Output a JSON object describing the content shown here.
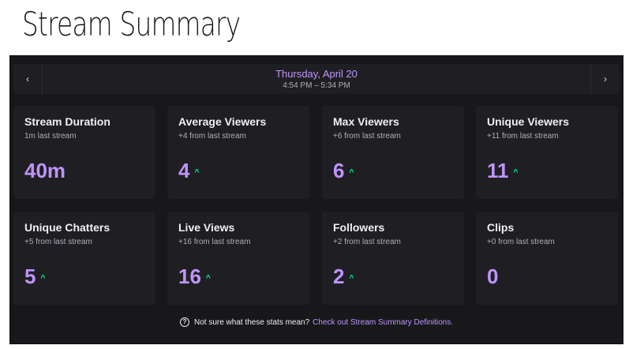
{
  "page_title": "Stream Summary",
  "date_nav": {
    "prev_icon": "‹",
    "next_icon": "›",
    "date": "Thursday, April 20",
    "time_range": "4:54 PM – 5:34 PM"
  },
  "stats": [
    {
      "title": "Stream Duration",
      "subtitle": "1m last stream",
      "value": "40m",
      "trend_icon": ""
    },
    {
      "title": "Average Viewers",
      "subtitle": "+4 from last stream",
      "value": "4",
      "trend_icon": "^"
    },
    {
      "title": "Max Viewers",
      "subtitle": "+6 from last stream",
      "value": "6",
      "trend_icon": "^"
    },
    {
      "title": "Unique Viewers",
      "subtitle": "+11 from last stream",
      "value": "11",
      "trend_icon": "^"
    },
    {
      "title": "Unique Chatters",
      "subtitle": "+5 from last stream",
      "value": "5",
      "trend_icon": "^"
    },
    {
      "title": "Live Views",
      "subtitle": "+16 from last stream",
      "value": "16",
      "trend_icon": "^"
    },
    {
      "title": "Followers",
      "subtitle": "+2 from last stream",
      "value": "2",
      "trend_icon": "^"
    },
    {
      "title": "Clips",
      "subtitle": "+0 from last stream",
      "value": "0",
      "trend_icon": ""
    }
  ],
  "footer": {
    "help_icon": "?",
    "text": "Not sure what these stats mean?",
    "link": "Check out Stream Summary Definitions."
  },
  "colors": {
    "accent": "#bf94ff",
    "trend_up": "#00f593",
    "panel_bg": "#18181b",
    "card_bg": "#1f1f23"
  }
}
